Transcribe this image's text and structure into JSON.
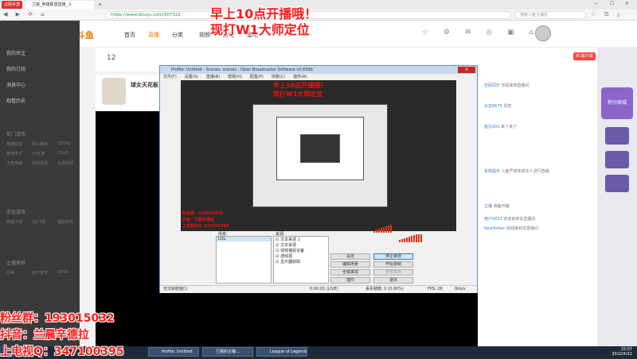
{
  "browser": {
    "logo_label": "云助手游",
    "tab_title": "兰晨_英雄联盟直播_斗",
    "new_tab": "+",
    "window_controls": "— ☐ ✕",
    "nav_controls": "◀ ▶ ⟳ ⌂",
    "url": "https://www.douyu.com/307322",
    "search_placeholder": "搜索斗鱼主播名",
    "tools": "☆ ☰ ⤓"
  },
  "douyu_header": {
    "brand": "斗鱼",
    "nav": [
      "首页",
      "直播",
      "分类",
      "视频",
      "游戏",
      "鱼吧"
    ],
    "icons": "☆ ⚙ ✉ ◎ ▣ ⌂"
  },
  "sidebar": {
    "items": [
      "我的关注",
      "我的订阅",
      "消息中心",
      "观看历史"
    ],
    "sections": [
      "热门游戏",
      "手机游戏",
      "主播推荐"
    ],
    "subitems": [
      [
        "英雄联盟",
        "和平精英",
        "DOTA2"
      ],
      [
        "绝地求生",
        "CF手游",
        "CSGO"
      ],
      [
        "王者荣耀",
        "炉石传说",
        "永劫无间"
      ],
      [
        "穿越火线",
        "QQ飞车",
        "魔兽世界"
      ],
      [
        "原神",
        "崩坏星穹",
        "DOTA"
      ]
    ]
  },
  "topstrip": {
    "count": "12"
  },
  "room": {
    "name": "球女天花板"
  },
  "rightpanel": {
    "pc_label": "PC客户端",
    "chat": [
      {
        "user": "全民同乐",
        "text": "欢迎来到直播间"
      },
      {
        "user": "水友8675",
        "text": "贵宾"
      },
      {
        "user": "鱼丸001",
        "text": "来了来了"
      },
      {
        "user": "系统提示",
        "text": "斗鱼严禁未成年人进行直播"
      },
      {
        "user": "主播",
        "text": "准备开播"
      },
      {
        "user": "用户5832",
        "text": "欢迎来到本直播间"
      },
      {
        "user": "NewYorker",
        "text": "欢迎来到本直播间"
      }
    ]
  },
  "farright": {
    "ad_label": "积分商城"
  },
  "obs": {
    "title": "Profile: Untitled - Scenes: scenes - Open Broadcaster Software v0.659b",
    "close_label": "✕",
    "menu": [
      "文件(F)",
      "设置(S)",
      "直播(B)",
      "帮助(H)",
      "配置(P)",
      "场景(C)",
      "插件(A)"
    ],
    "overlay_line1": "早上10点开播哦！",
    "overlay_line2": "现打W1大师定位",
    "overlay_small1": "粉丝群：193015032",
    "overlay_small2": "抖音：兰晨辛德拉",
    "overlay_small3": "上电视QQ: 347100395",
    "scenes_header": "场景:",
    "scenes": [
      "LOL"
    ],
    "sources_header": "来源:",
    "sources": [
      "文本来源 1",
      "文本来源",
      "视频捕捉设备",
      "游戏源",
      "显示器获取"
    ],
    "buttons": {
      "settings": "设定",
      "start_stream": "停止串流",
      "edit_scene": "编辑场景",
      "start_record": "开始录制",
      "global_sources": "全域来源",
      "preview": "预览串流",
      "plugins": "插件",
      "exit": "退出"
    },
    "status": {
      "left": "无法获取窗口",
      "time": "0:00:01 (LIVE)",
      "dropped": "丢失帧数: 0 (0.00%)",
      "fps": "FPS: 28",
      "bitrate": "0kb/s"
    }
  },
  "promo": {
    "line1": "早上10点开播哦！",
    "line2": "现打W1大师定位"
  },
  "overlay_bottom": {
    "fans": "粉丝群：193015032",
    "douyin": "抖音：兰晨辛德拉",
    "mic": "上电视Q：347100395"
  },
  "taskbar": {
    "tasks": [
      "Profile: Untitled",
      "兰晨的主播...",
      "League of Legends"
    ],
    "time": "15:07",
    "date": "2022/4/22"
  }
}
